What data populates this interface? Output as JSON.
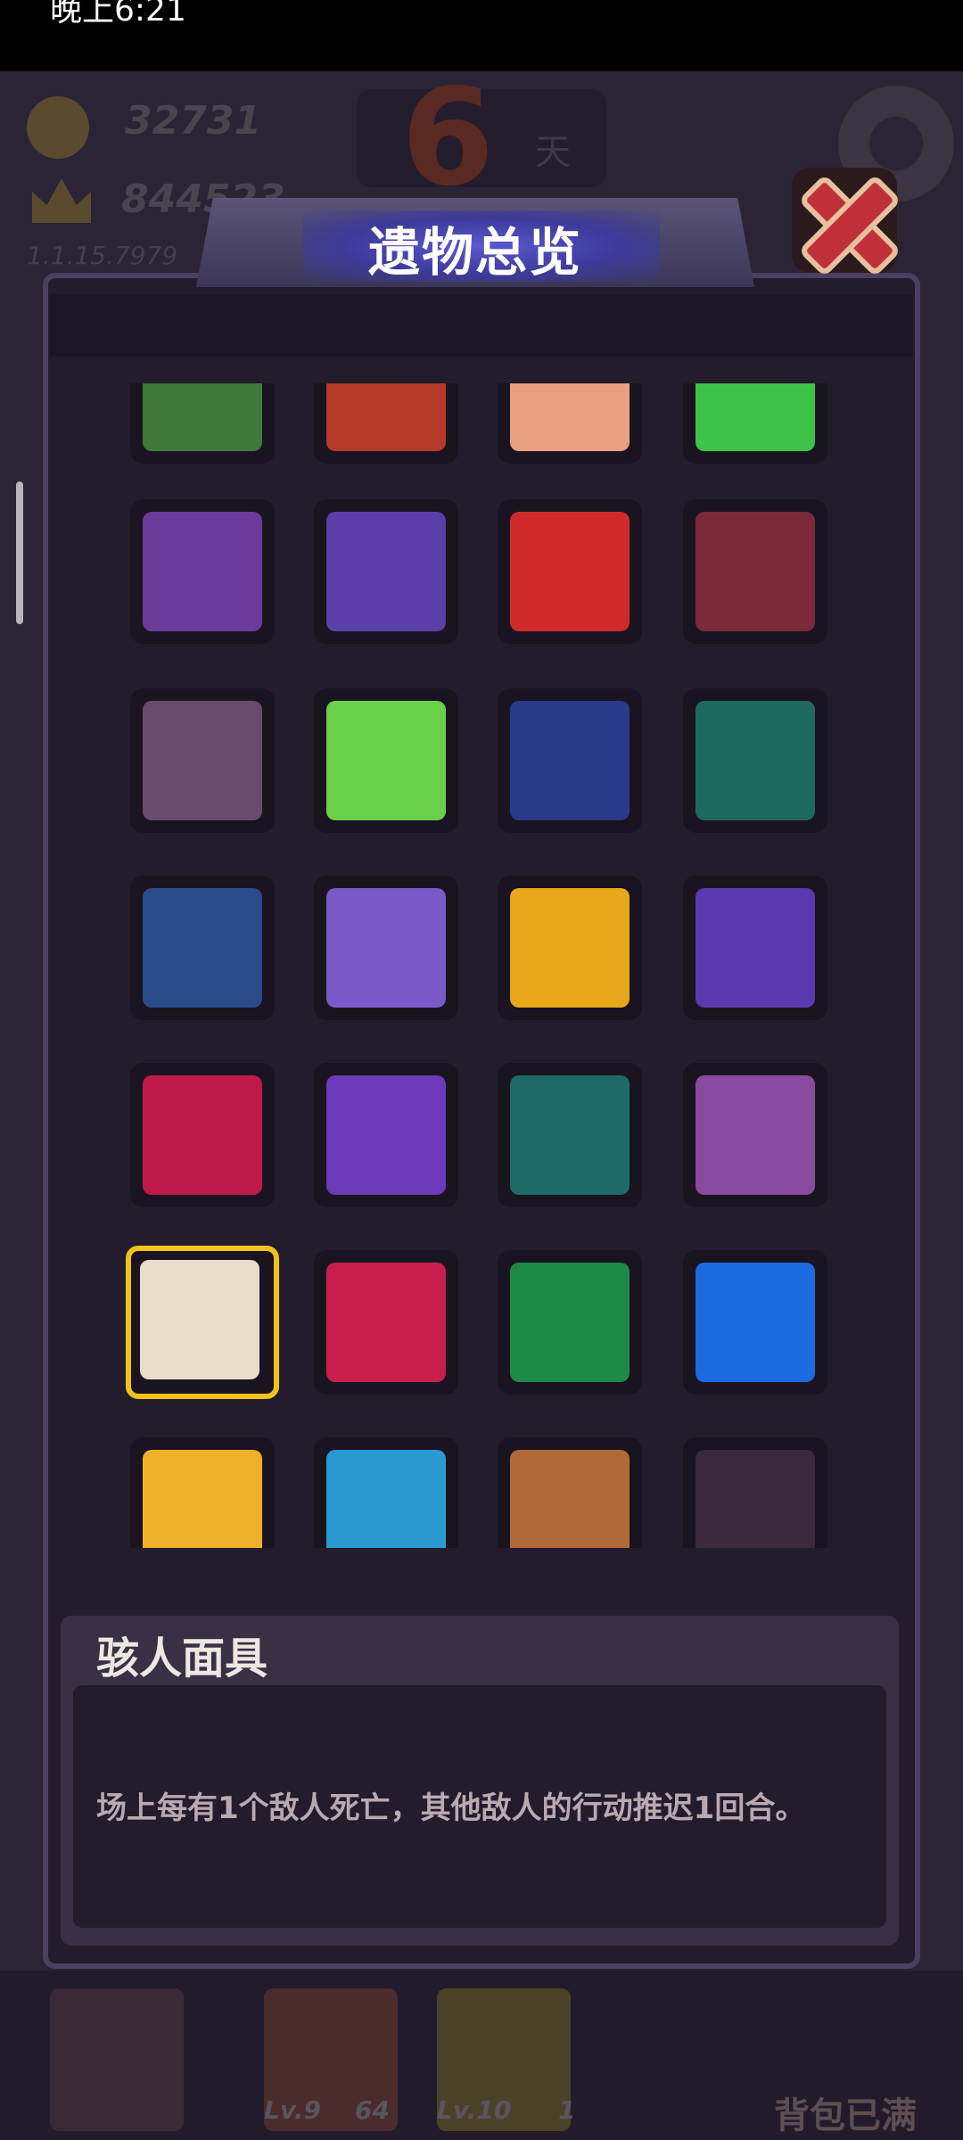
{
  "status_bar": {
    "time": "晚上6:21",
    "right": ""
  },
  "background_hud": {
    "coins": "32731",
    "crowns": "844523",
    "version": "1.1.15.7979",
    "day_number": "6",
    "day_unit": "天",
    "slots": [
      {
        "level": "Lv.9",
        "count": "64"
      },
      {
        "level": "Lv.10",
        "count": "1"
      }
    ],
    "bag_full": "背包已满"
  },
  "dialog": {
    "title": "遗物总览",
    "selected_relic": {
      "name": "骇人面具",
      "description": "场上每有1个敌人死亡，其他敌人的行动推迟1回合。"
    },
    "relic_icons": [
      [
        "turtle-shell-icon",
        "red-scroll-icon",
        "fist-icon",
        "green-gem-icon"
      ],
      [
        "purple-axe-icon",
        "striped-beanie-icon",
        "number-four-icon",
        "fanged-mouth-icon"
      ],
      [
        "crossed-card-icon",
        "slime-paint-icon",
        "toy-soldier-icon",
        "ghost-statue-icon"
      ],
      [
        "green-trident-icon",
        "firework-rocket-icon",
        "thumbs-up-icon",
        "color-grid-icon"
      ],
      [
        "red-skull-cloak-icon",
        "purple-monster-hat-icon",
        "mute-speaker-icon",
        "voodoo-doll-icon"
      ],
      [
        "plague-mask-icon",
        "red-devil-icon",
        "circus-tent-icon",
        "blue-cube-icon"
      ],
      [
        "rocket-bundle-icon",
        "blue-flame-skull-icon",
        "wooden-torch-icon",
        "grand-piano-icon"
      ]
    ]
  }
}
